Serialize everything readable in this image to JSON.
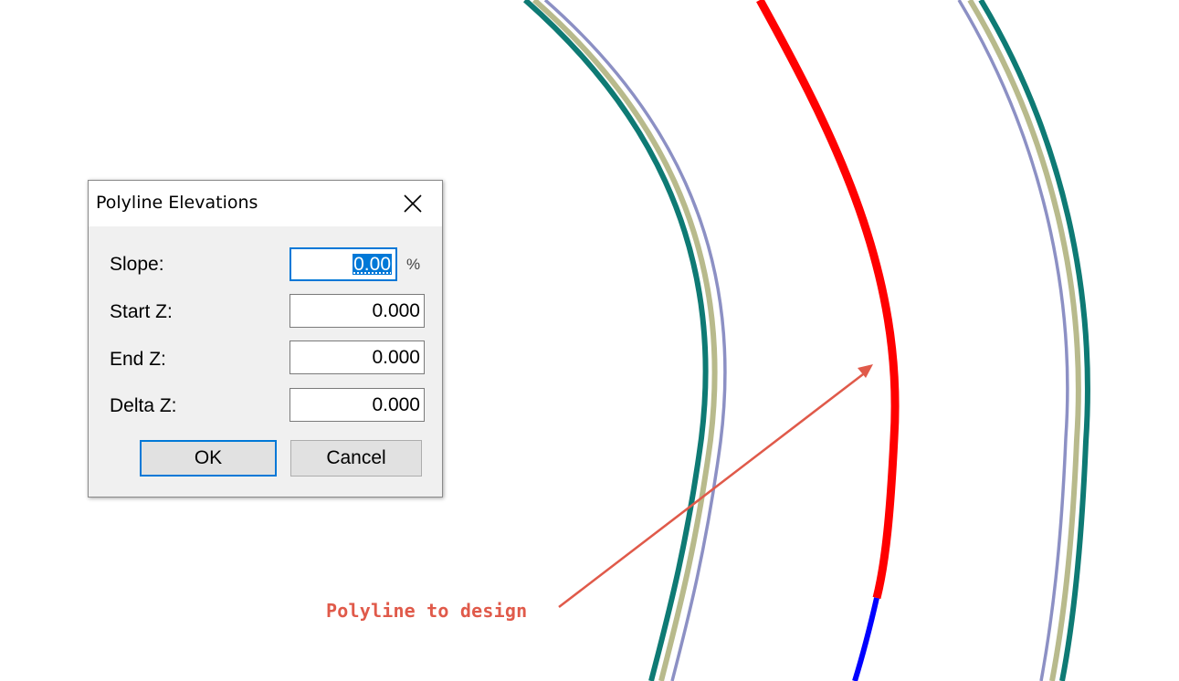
{
  "dialog": {
    "title": "Polyline Elevations",
    "close_icon": "close-icon",
    "fields": {
      "slope": {
        "label": "Slope:",
        "value": "0.00",
        "unit": "%"
      },
      "start_z": {
        "label": "Start Z:",
        "value": "0.000"
      },
      "end_z": {
        "label": "End Z:",
        "value": "0.000"
      },
      "delta_z": {
        "label": "Delta Z:",
        "value": "0.000"
      }
    },
    "buttons": {
      "ok": "OK",
      "cancel": "Cancel"
    }
  },
  "annotation": {
    "text": "Polyline to design",
    "color": "#e05a4a"
  },
  "drawing": {
    "colors": {
      "teal": "#0e7a74",
      "khaki": "#b8ba8c",
      "lavender": "#8c90c4",
      "red": "#ff0000",
      "blue": "#0000ff",
      "arrow": "#e05a4a"
    }
  }
}
